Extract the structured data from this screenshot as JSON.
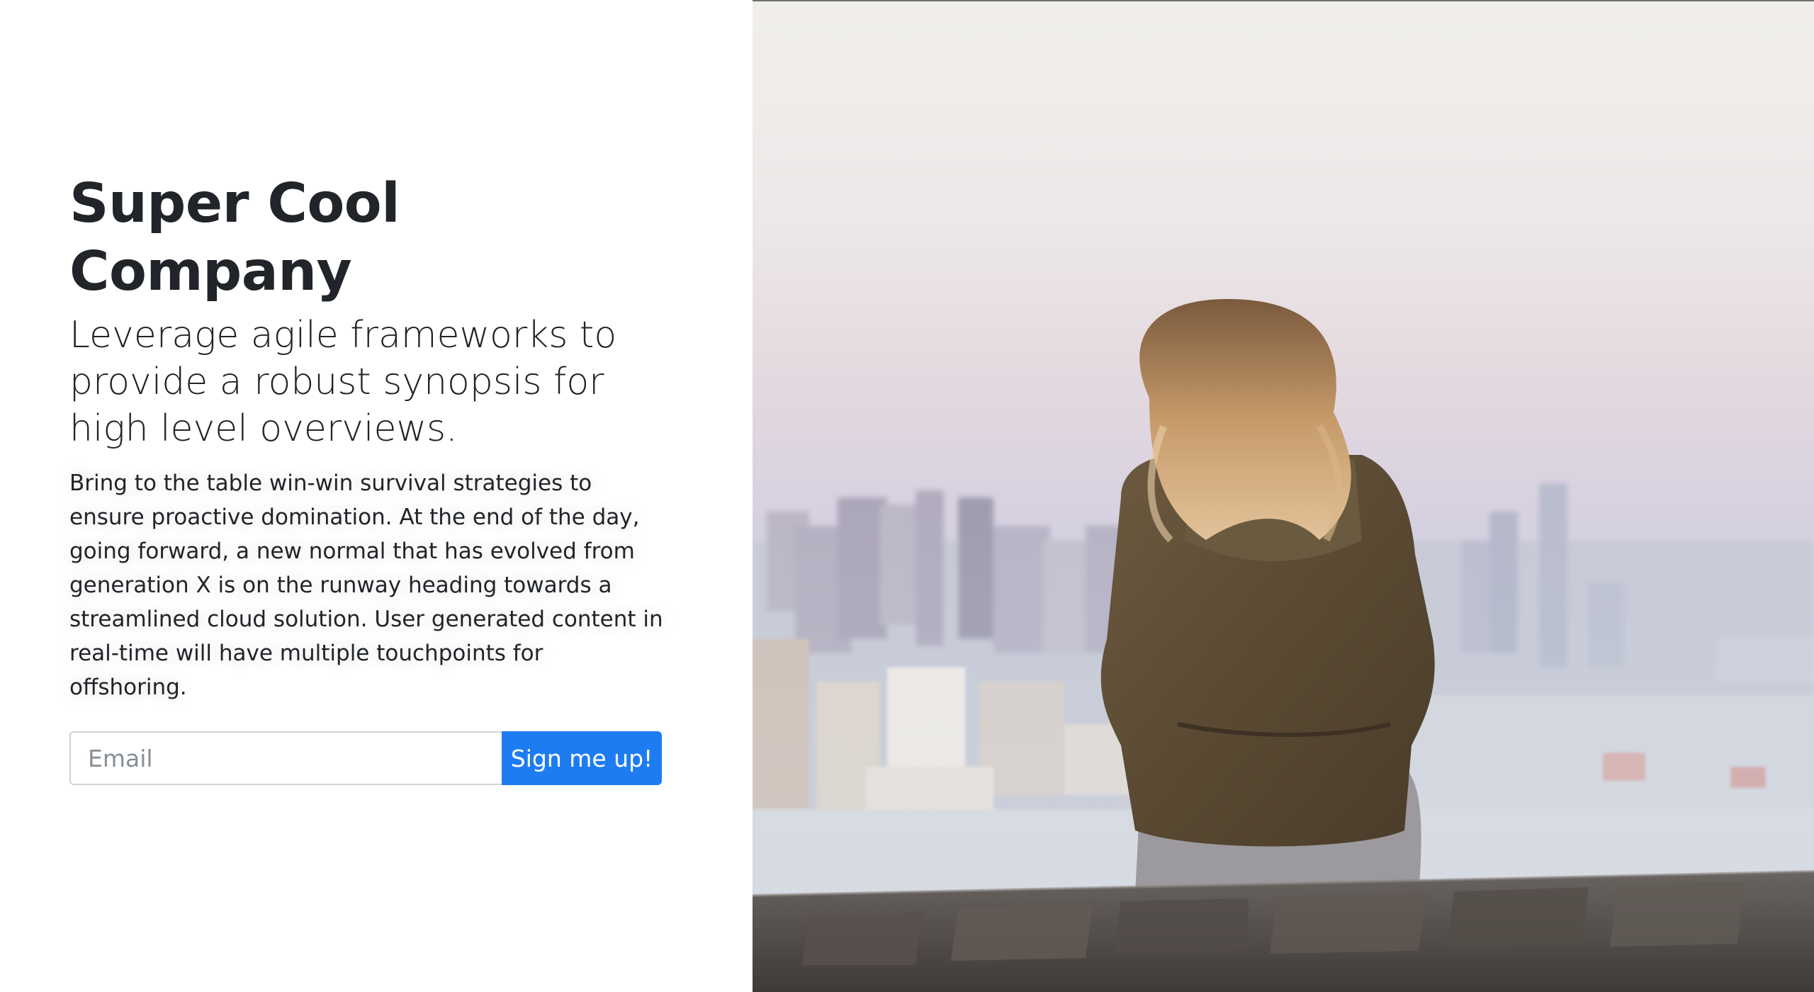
{
  "hero": {
    "title": "Super Cool Company",
    "lead": "Leverage agile frameworks to provide a robust synopsis for high level overviews.",
    "body": "Bring to the table win-win survival strategies to ensure proactive domination. At the end of the day, going forward, a new normal that has evolved from generation X is on the runway heading towards a streamlined cloud solution. User generated content in real-time will have multiple touchpoints for offshoring."
  },
  "signup": {
    "email_placeholder": "Email",
    "email_value": "",
    "button_label": "Sign me up!"
  },
  "colors": {
    "accent": "#1e7cf2",
    "text": "#212529"
  }
}
